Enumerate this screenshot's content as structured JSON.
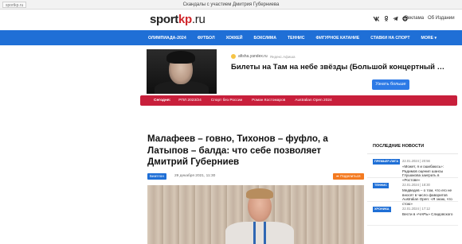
{
  "browser": {
    "url": "sportkp.ru",
    "tab_title": "Скандалы с участием Дмитрия Губерниева"
  },
  "header": {
    "logo_sport": "sport",
    "logo_kp": "kp",
    "logo_ru": ".ru",
    "social_icons": [
      "vk-icon",
      "ok-icon",
      "telegram-icon",
      "dzen-icon"
    ],
    "ad_link": "Реклама",
    "about_link": "Об Издании"
  },
  "nav": {
    "items": [
      "ОЛИМПИАДА-2024",
      "ФУТБОЛ",
      "ХОККЕЙ",
      "БОКС/ММА",
      "ТЕННИС",
      "ФИГУРНОЕ КАТАНИЕ",
      "СТАВКИ НА СПОРТ",
      "MORE"
    ],
    "more_arrow": "▾"
  },
  "ad": {
    "source": "afisha.yandex.ru",
    "source_hint": "Яндекс.Афиша",
    "headline": "Билеты на Там на небе звёзды (Большой концертный зал...",
    "cta": "Узнать больше"
  },
  "tags": {
    "today": "Сегодня:",
    "items": [
      "РПЛ 2023/24",
      "Спорт без России",
      "Роман Костомаров",
      "Australian Open 2024"
    ]
  },
  "article": {
    "title": "Малафеев – говно, Тихонов – фуфло, а Латыпов – балда: что себе позволяет Дмитрий Губерниев",
    "category": "Биатлон",
    "date": "29 декабря 2021, 11:30",
    "share": "Поделиться"
  },
  "sidebar": {
    "heading": "ПОСЛЕДНИЕ НОВОСТИ",
    "news": [
      {
        "category": "ПРЕМЬЕР-ЛИГА",
        "time": "22.01.2024 | 20:56",
        "text": "«Может, я и ошибаюсь»: Радимов оценил шансы Глушакова заиграть в «Ростове»"
      },
      {
        "category": "ТЕННИС",
        "time": "22.01.2024 | 18:30",
        "text": "Медведев – о том, что его не вносят в число фаворитов Australian Open: «Я знаю, что стою»"
      },
      {
        "category": "ХРОНИКА",
        "time": "22.01.2024 | 17:12",
        "text": "Вести в «ЧАРЬ» Слидовского"
      }
    ]
  }
}
